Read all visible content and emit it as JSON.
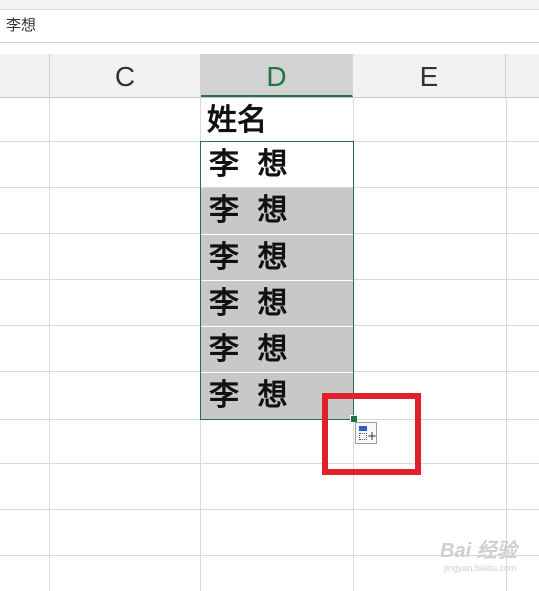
{
  "formula_bar": {
    "content": "李想"
  },
  "columns": {
    "c": "C",
    "d": "D",
    "e": "E"
  },
  "cells": {
    "header": "姓名",
    "names": [
      "李 想",
      "李 想",
      "李 想",
      "李 想",
      "李 想",
      "李 想"
    ]
  },
  "colors": {
    "selection": "#217346",
    "highlight_box": "#e0202a",
    "fill_shade": "#c8c8c8"
  },
  "icons": {
    "autofill_options": "auto-fill-options-icon"
  },
  "watermark": {
    "main": "Bai 经验",
    "sub": "jingyan.baidu.com"
  }
}
